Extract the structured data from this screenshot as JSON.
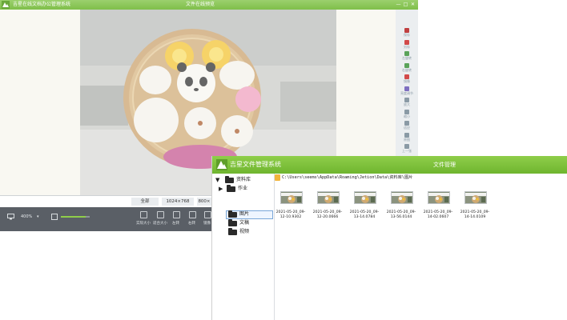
{
  "bg_window": {
    "app_title": "吉星在线文档办公管理系统",
    "center_title": "文件在线预览",
    "window_buttons": [
      "—",
      "□",
      "✕"
    ],
    "right_toolbar": [
      {
        "label": "保存",
        "icon": "save-icon",
        "color": "#c04040"
      },
      {
        "label": "另存",
        "icon": "save-as-icon",
        "color": "#d24a4a"
      },
      {
        "label": "左旋转",
        "icon": "rotate-left-icon",
        "color": "#5aa35a"
      },
      {
        "label": "右旋转",
        "icon": "rotate-right-icon",
        "color": "#5aa35a"
      },
      {
        "label": "镜像",
        "icon": "mirror-icon",
        "color": "#d24a4a"
      },
      {
        "label": "亮度调节",
        "icon": "brightness-icon",
        "color": "#7e6fc0"
      },
      {
        "label": "放大",
        "icon": "zoom-in-icon",
        "color": "#8a9aa5"
      },
      {
        "label": "缩小",
        "icon": "zoom-out-icon",
        "color": "#8a9aa5"
      },
      {
        "label": "适应",
        "icon": "fit-icon",
        "color": "#8a9aa5"
      },
      {
        "label": "原图",
        "icon": "original-size-icon",
        "color": "#8a9aa5"
      },
      {
        "label": "上一张",
        "icon": "previous-icon",
        "color": "#8a9aa5"
      },
      {
        "label": "下一张",
        "icon": "next-icon",
        "color": "#8a9aa5"
      }
    ],
    "size_buttons": [
      "全部",
      "1024×768",
      "800×"
    ],
    "bottom": {
      "zoom_value": "400%",
      "zoom_level": 0.85,
      "tools": [
        "实际大小",
        "适合大小",
        "左转",
        "右转",
        "镜像"
      ]
    }
  },
  "file_manager": {
    "title": "吉星文件管理系统",
    "center_title": "文件管理",
    "tree": [
      {
        "label": "资料库",
        "expanded": true
      },
      {
        "label": "作业",
        "expanded": false
      },
      {
        "label": "图片",
        "selected": true
      },
      {
        "label": "文稿"
      },
      {
        "label": "视频"
      }
    ],
    "path": "C:\\Users\\seems\\AppData\\Roaming\\Jetion\\Data\\资料库\\图片",
    "files": [
      {
        "name_line1": "2021-05-20_09-",
        "name_line2": "12-10.9302"
      },
      {
        "name_line1": "2021-05-20_09-",
        "name_line2": "12-20.0666"
      },
      {
        "name_line1": "2021-05-20_09-",
        "name_line2": "13-14.0784"
      },
      {
        "name_line1": "2021-05-20_09-",
        "name_line2": "13-56.0144"
      },
      {
        "name_line1": "2021-05-20_09-",
        "name_line2": "14-02.0607"
      },
      {
        "name_line1": "2021-05-20_09-",
        "name_line2": "14-14.0109"
      }
    ]
  },
  "colors": {
    "titlebar_green": "#7fbf4a",
    "fm_green": "#6fb52f",
    "bottombar": "#5a5f66",
    "zoom_slider": "#8fce4a"
  }
}
